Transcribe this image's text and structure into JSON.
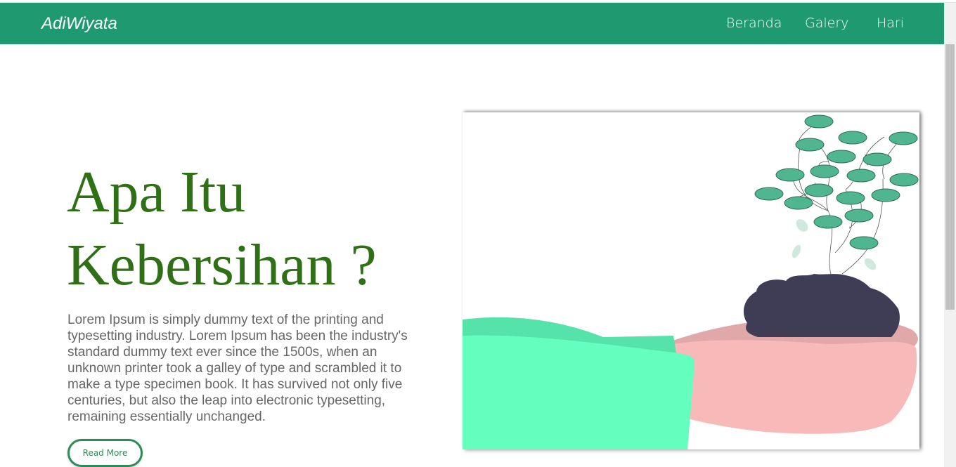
{
  "navbar": {
    "brand": "AdiWiyata",
    "links": [
      {
        "label": "Beranda"
      },
      {
        "label": "Galery"
      },
      {
        "label": "Hari"
      }
    ],
    "color": "#1e9970"
  },
  "hero": {
    "title_line1": "Apa Itu",
    "title_line2": "Kebersihan ?",
    "paragraph": "Lorem Ipsum is simply dummy text of the printing and typesetting industry. Lorem Ipsum has been the industry's standard dummy text ever since the 1500s, when an unknown printer took a galley of type and scrambled it to make a type specimen book. It has survived not only five centuries, but also the leap into electronic typesetting, remaining essentially unchanged.",
    "read_more_label": "Read More",
    "title_color": "#2f6f16"
  },
  "illustration": {
    "icon": "hands-holding-plant-illustration",
    "colors": {
      "leaf": "#4fb68f",
      "soil": "#3f3d56",
      "sleeve": "#64ffbf",
      "hand": "#f8b9b9"
    }
  }
}
